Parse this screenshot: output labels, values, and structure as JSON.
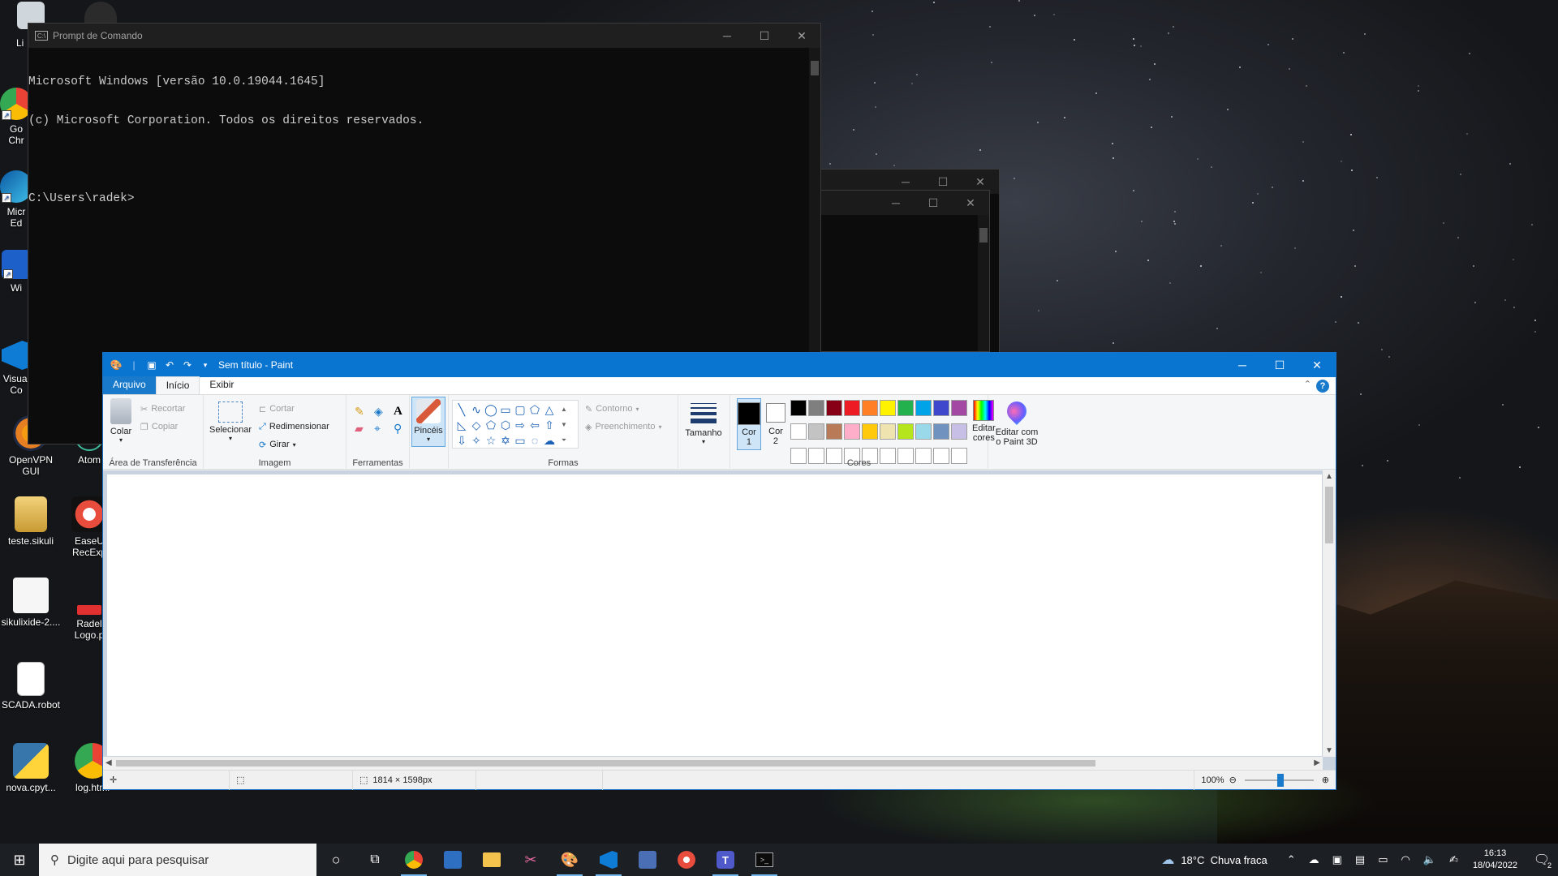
{
  "desktop": {
    "icons": [
      {
        "label": "Li",
        "icon": "recycle-bin-icon"
      },
      {
        "label": "Go\nChr",
        "icon": "chrome-icon"
      },
      {
        "label": "Micr\nEd",
        "icon": "edge-icon"
      },
      {
        "label": "Wi",
        "icon": "app-icon"
      },
      {
        "label": "Visual\nCo",
        "icon": "vscode-icon"
      },
      {
        "label": "OpenVPN\nGUI",
        "icon": "openvpn-icon"
      },
      {
        "label": "Atom",
        "icon": "atom-icon"
      },
      {
        "label": "teste.sikuli",
        "icon": "folder-icon"
      },
      {
        "label": "EaseU\nRecExp",
        "icon": "recexperts-icon"
      },
      {
        "label": "sikulixide-2....",
        "icon": "java-icon"
      },
      {
        "label": "Radel\nLogo.p",
        "icon": "image-icon"
      },
      {
        "label": "SCADA.robot",
        "icon": "document-icon"
      },
      {
        "label": "nova.cpyt...",
        "icon": "python-icon"
      },
      {
        "label": "log.html",
        "icon": "chrome-icon"
      }
    ]
  },
  "cmd": {
    "title": "Prompt de Comando",
    "lines": [
      "Microsoft Windows [versão 10.0.19044.1645]",
      "(c) Microsoft Corporation. Todos os direitos reservados.",
      "",
      "C:\\Users\\radek>"
    ]
  },
  "paint": {
    "title": "Sem título - Paint",
    "tabs": [
      "Arquivo",
      "Início",
      "Exibir"
    ],
    "groups": {
      "clipboard": {
        "label": "Área de Transferência",
        "paste": "Colar",
        "cut": "Recortar",
        "copy": "Copiar"
      },
      "image": {
        "label": "Imagem",
        "select": "Selecionar",
        "crop": "Cortar",
        "resize": "Redimensionar",
        "rotate": "Girar"
      },
      "tools": {
        "label": "Ferramentas"
      },
      "brushes": {
        "label": "Pincéis"
      },
      "shapes": {
        "label": "Formas",
        "outline": "Contorno",
        "fill": "Preenchimento"
      },
      "size": {
        "label": "Tamanho"
      },
      "colors": {
        "label": "Cores",
        "color1": "Cor\n1",
        "color2": "Cor\n2",
        "edit": "Editar\ncores"
      },
      "paint3d": {
        "label": "Editar com\no Paint 3D"
      }
    },
    "palette": [
      "#000000",
      "#7f7f7f",
      "#880015",
      "#ed1c24",
      "#ff7f27",
      "#fff200",
      "#22b14c",
      "#00a2e8",
      "#3f48cc",
      "#a349a4",
      "#ffffff",
      "#c3c3c3",
      "#b97a57",
      "#ffaec9",
      "#ffc90e",
      "#efe4b0",
      "#b5e61d",
      "#99d9ea",
      "#7092be",
      "#c8bfe7",
      "#ffffff",
      "#ffffff",
      "#ffffff",
      "#ffffff",
      "#ffffff",
      "#ffffff",
      "#ffffff",
      "#ffffff",
      "#ffffff",
      "#ffffff"
    ],
    "status": {
      "size": "1814 × 1598px",
      "zoom": "100%"
    }
  },
  "taskbar": {
    "search_placeholder": "Digite aqui para pesquisar",
    "weather": "18°C  Chuva fraca",
    "time": "16:13",
    "date": "18/04/2022",
    "notifications": "2"
  }
}
